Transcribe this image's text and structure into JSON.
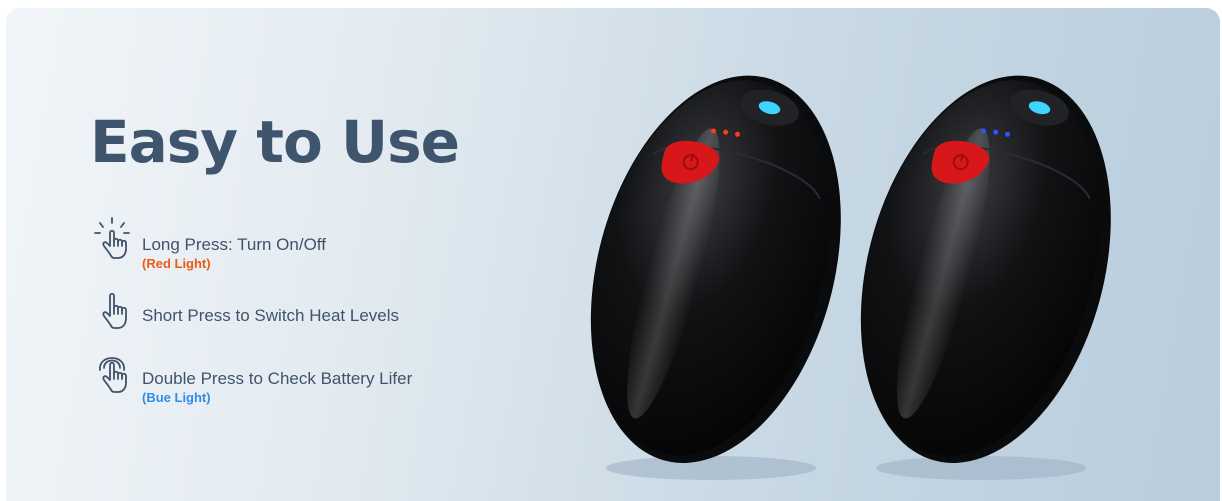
{
  "banner": {
    "title": "Easy to Use",
    "features": [
      {
        "icon": "tap-glow-icon",
        "label": "Long Press: Turn On/Off",
        "note": "(Red Light)",
        "note_color": "#ee5a13"
      },
      {
        "icon": "tap-finger-icon",
        "label": "Short Press to Switch Heat Levels"
      },
      {
        "icon": "double-tap-icon",
        "label": "Double Press to Check Battery Lifer",
        "note": "(Bue Light)",
        "note_color": "#2e8ee6"
      }
    ]
  },
  "products": [
    {
      "name": "hand-warmer-red-indicators",
      "indicator_color": "#ff3b1f",
      "button_color": "#d8171b",
      "top_light": "#3fd4ff"
    },
    {
      "name": "hand-warmer-blue-indicators",
      "indicator_color": "#2f55ff",
      "button_color": "#d8171b",
      "top_light": "#3fd4ff"
    }
  ]
}
